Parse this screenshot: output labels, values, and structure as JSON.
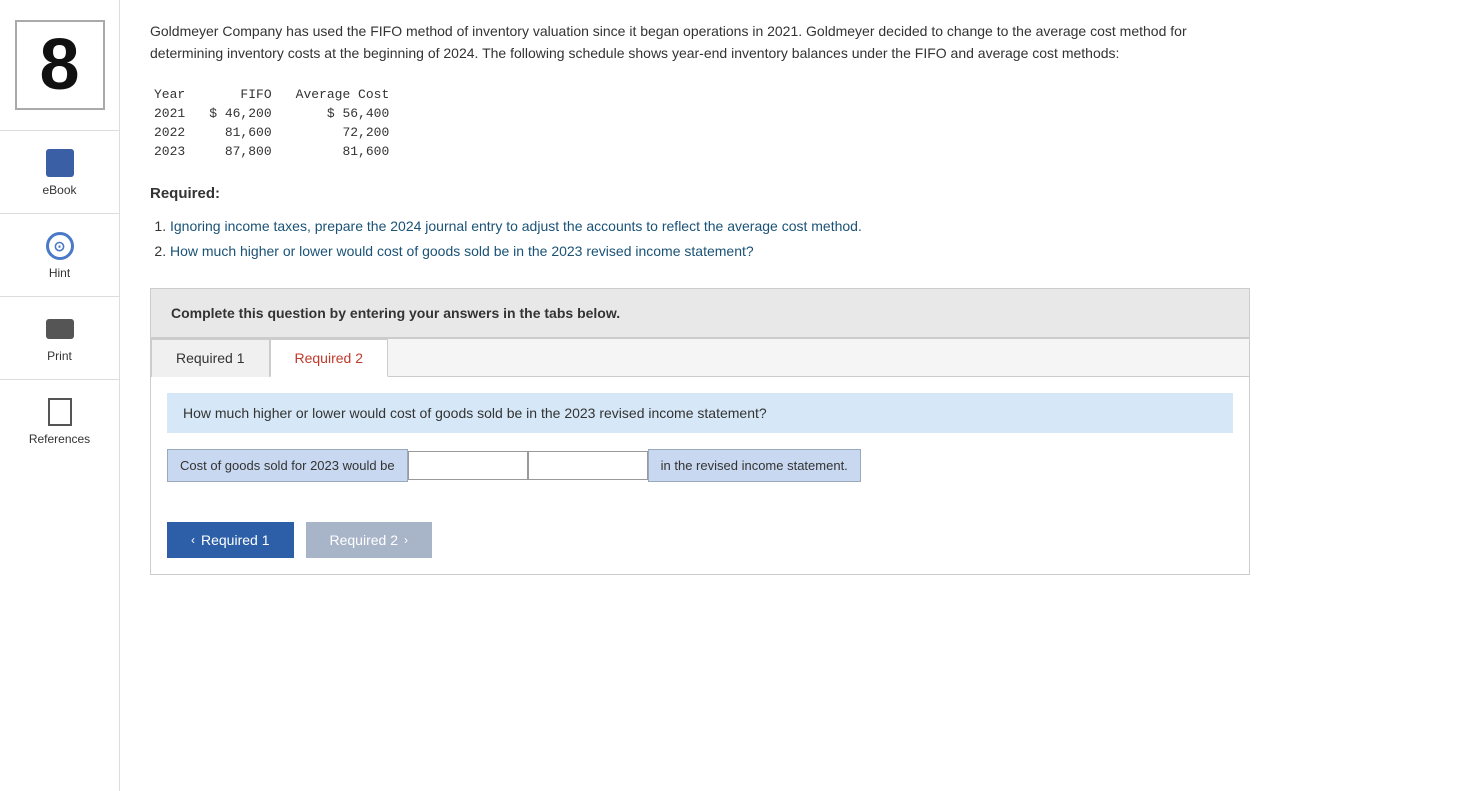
{
  "sidebar": {
    "number": "8",
    "items": [
      {
        "id": "ebook",
        "label": "eBook",
        "icon": "ebook-icon"
      },
      {
        "id": "hint",
        "label": "Hint",
        "icon": "hint-icon"
      },
      {
        "id": "print",
        "label": "Print",
        "icon": "print-icon"
      },
      {
        "id": "references",
        "label": "References",
        "icon": "references-icon"
      }
    ]
  },
  "problem": {
    "text": "Goldmeyer Company has used the FIFO method of inventory valuation since it began operations in 2021. Goldmeyer decided to change to the average cost method for determining inventory costs at the beginning of 2024. The following schedule shows year-end inventory balances under the FIFO and average cost methods:"
  },
  "table": {
    "headers": [
      "Year",
      "FIFO",
      "Average Cost"
    ],
    "rows": [
      [
        "2021",
        "$ 46,200",
        "$ 56,400"
      ],
      [
        "2022",
        "81,600",
        "72,200"
      ],
      [
        "2023",
        "87,800",
        "81,600"
      ]
    ]
  },
  "required_label": "Required:",
  "required_items": [
    "Ignoring income taxes, prepare the 2024 journal entry to adjust the accounts to reflect the average cost method.",
    "How much higher or lower would cost of goods sold be in the 2023 revised income statement?"
  ],
  "complete_box": {
    "text": "Complete this question by entering your answers in the tabs below."
  },
  "tabs": [
    {
      "id": "required1",
      "label": "Required 1",
      "active": false
    },
    {
      "id": "required2",
      "label": "Required 2",
      "active": true
    }
  ],
  "tab2": {
    "question": "How much higher or lower would cost of goods sold be in the 2023 revised income statement?",
    "answer_label": "Cost of goods sold for 2023 would be",
    "answer_suffix": "in the revised income statement.",
    "amount_placeholder": "",
    "direction_placeholder": ""
  },
  "nav": {
    "btn1_label": "Required 1",
    "btn1_chevron": "‹",
    "btn2_label": "Required 2",
    "btn2_chevron": "›"
  }
}
